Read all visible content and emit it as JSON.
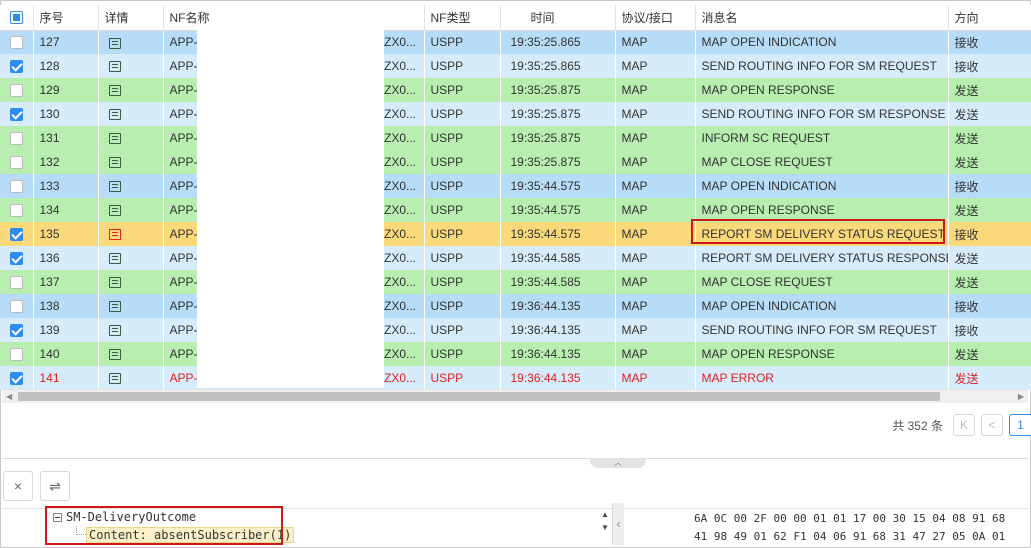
{
  "columns": [
    "序号",
    "详情",
    "NF名称",
    "NF类型",
    "时间",
    "协议/接口",
    "消息名",
    "方向"
  ],
  "rows": [
    {
      "no": "127",
      "nf": "APP-",
      "nf2": "ZX0...",
      "type": "USPP",
      "time": "19:35:25.865",
      "proto": "MAP",
      "msg": "MAP OPEN INDICATION",
      "dir": "接收",
      "checked": false,
      "style": "blue"
    },
    {
      "no": "128",
      "nf": "APP-",
      "nf2": "ZX0...",
      "type": "USPP",
      "time": "19:35:25.865",
      "proto": "MAP",
      "msg": "SEND ROUTING INFO FOR SM REQUEST",
      "dir": "接收",
      "checked": true,
      "style": "light"
    },
    {
      "no": "129",
      "nf": "APP-",
      "nf2": "ZX0...",
      "type": "USPP",
      "time": "19:35:25.875",
      "proto": "MAP",
      "msg": "MAP OPEN RESPONSE",
      "dir": "发送",
      "checked": false,
      "style": "green"
    },
    {
      "no": "130",
      "nf": "APP-",
      "nf2": "ZX0...",
      "type": "USPP",
      "time": "19:35:25.875",
      "proto": "MAP",
      "msg": "SEND ROUTING INFO FOR SM RESPONSE",
      "dir": "发送",
      "checked": true,
      "style": "light"
    },
    {
      "no": "131",
      "nf": "APP-",
      "nf2": "ZX0...",
      "type": "USPP",
      "time": "19:35:25.875",
      "proto": "MAP",
      "msg": "INFORM SC REQUEST",
      "dir": "发送",
      "checked": false,
      "style": "green"
    },
    {
      "no": "132",
      "nf": "APP-",
      "nf2": "ZX0...",
      "type": "USPP",
      "time": "19:35:25.875",
      "proto": "MAP",
      "msg": "MAP CLOSE REQUEST",
      "dir": "发送",
      "checked": false,
      "style": "green"
    },
    {
      "no": "133",
      "nf": "APP-",
      "nf2": "ZX0...",
      "type": "USPP",
      "time": "19:35:44.575",
      "proto": "MAP",
      "msg": "MAP OPEN INDICATION",
      "dir": "接收",
      "checked": false,
      "style": "blue"
    },
    {
      "no": "134",
      "nf": "APP-",
      "nf2": "ZX0...",
      "type": "USPP",
      "time": "19:35:44.575",
      "proto": "MAP",
      "msg": "MAP OPEN RESPONSE",
      "dir": "发送",
      "checked": false,
      "style": "green"
    },
    {
      "no": "135",
      "nf": "APP-",
      "nf2": "ZX0...",
      "type": "USPP",
      "time": "19:35:44.575",
      "proto": "MAP",
      "msg": "REPORT SM DELIVERY STATUS REQUEST",
      "dir": "接收",
      "checked": true,
      "style": "sel"
    },
    {
      "no": "136",
      "nf": "APP-",
      "nf2": "ZX0...",
      "type": "USPP",
      "time": "19:35:44.585",
      "proto": "MAP",
      "msg": "REPORT SM DELIVERY STATUS RESPONSE",
      "dir": "发送",
      "checked": true,
      "style": "light"
    },
    {
      "no": "137",
      "nf": "APP-",
      "nf2": "ZX0...",
      "type": "USPP",
      "time": "19:35:44.585",
      "proto": "MAP",
      "msg": "MAP CLOSE REQUEST",
      "dir": "发送",
      "checked": false,
      "style": "green"
    },
    {
      "no": "138",
      "nf": "APP-",
      "nf2": "ZX0...",
      "type": "USPP",
      "time": "19:36:44.135",
      "proto": "MAP",
      "msg": "MAP OPEN INDICATION",
      "dir": "接收",
      "checked": false,
      "style": "blue"
    },
    {
      "no": "139",
      "nf": "APP-",
      "nf2": "ZX0...",
      "type": "USPP",
      "time": "19:36:44.135",
      "proto": "MAP",
      "msg": "SEND ROUTING INFO FOR SM REQUEST",
      "dir": "接收",
      "checked": true,
      "style": "light"
    },
    {
      "no": "140",
      "nf": "APP-",
      "nf2": "ZX0...",
      "type": "USPP",
      "time": "19:36:44.135",
      "proto": "MAP",
      "msg": "MAP OPEN RESPONSE",
      "dir": "发送",
      "checked": false,
      "style": "green"
    },
    {
      "no": "141",
      "nf": "APP-",
      "nf2": "ZX0...",
      "type": "USPP",
      "time": "19:36:44.135",
      "proto": "MAP",
      "msg": "MAP ERROR",
      "dir": "发送",
      "checked": true,
      "style": "err"
    }
  ],
  "pager": {
    "total_label": "共 352 条",
    "current_page": "1",
    "prev_first": "K",
    "prev": "<"
  },
  "toolbar": {
    "close_glyph": "×",
    "swap_glyph": "⇌"
  },
  "tree": {
    "root": "SM-DeliveryOutcome",
    "child": "Content: absentSubscriber(1)"
  },
  "hex": {
    "line1": "6A 0C 00 2F 00 00 01 01 17 00 30 15 04 08 91 68",
    "line2": "41 98 49 01 62 F1 04 06 91 68 31 47 27 05 0A 01"
  },
  "colors": {
    "row_blue": "#b6dcf7",
    "row_light": "#d7ecfa",
    "row_green": "#b8eeb0",
    "row_selected": "#f9d97a",
    "error_text": "#e02020",
    "highlight_box": "#d01818",
    "accent": "#2e8cf0"
  }
}
